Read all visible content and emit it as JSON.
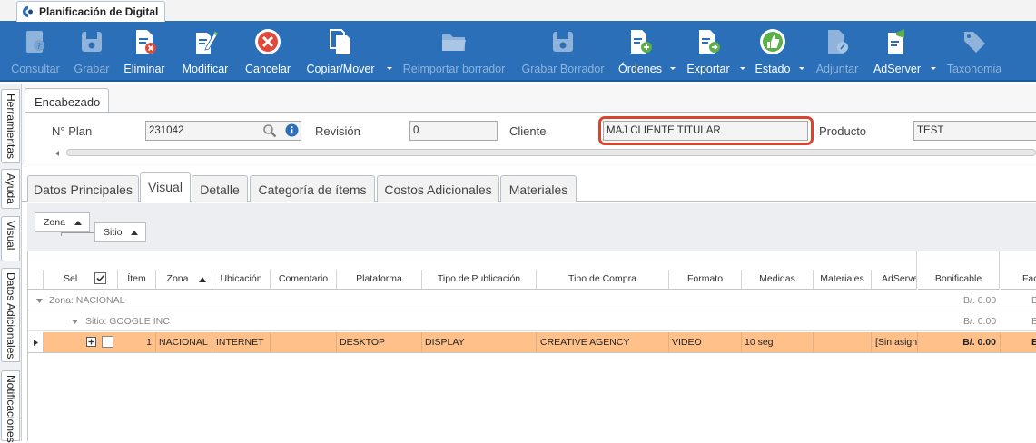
{
  "window": {
    "title": "Planificación de Digital"
  },
  "toolbar": {
    "buttons": [
      {
        "label": "Consultar",
        "icon": "consult-icon",
        "enabled": false
      },
      {
        "label": "Grabar",
        "icon": "save-icon",
        "enabled": false
      },
      {
        "label": "Eliminar",
        "icon": "delete-doc-icon",
        "enabled": true
      },
      {
        "label": "Modificar",
        "icon": "edit-doc-icon",
        "enabled": true
      },
      {
        "label": "Cancelar",
        "icon": "cancel-icon",
        "enabled": true
      },
      {
        "label": "Copiar/Mover",
        "icon": "copy-icon",
        "enabled": true
      },
      {
        "label": "Reimportar borrador",
        "icon": "folder-icon",
        "enabled": false
      },
      {
        "label": "Grabar Borrador",
        "icon": "save-draft-icon",
        "enabled": false
      },
      {
        "label": "Órdenes",
        "icon": "orders-icon",
        "enabled": true
      },
      {
        "label": "Exportar",
        "icon": "export-icon",
        "enabled": true
      },
      {
        "label": "Estado",
        "icon": "status-icon",
        "enabled": true
      },
      {
        "label": "Adjuntar",
        "icon": "attach-icon",
        "enabled": false
      },
      {
        "label": "AdServer",
        "icon": "adserver-icon",
        "enabled": true
      },
      {
        "label": "Taxonomia",
        "icon": "tag-icon",
        "enabled": false
      }
    ]
  },
  "sidebar": {
    "tabs": [
      "Herramientas",
      "Ayuda",
      "Visual",
      "Datos Adicionales",
      "Notificaciones"
    ]
  },
  "header": {
    "section_label": "Encabezado",
    "plan_label": "N° Plan",
    "plan_value": "231042",
    "revision_label": "Revisión",
    "revision_value": "0",
    "cliente_label": "Cliente",
    "cliente_value": "MAJ CLIENTE TITULAR",
    "producto_label": "Producto",
    "producto_value": "TEST"
  },
  "tabs": [
    "Datos Principales",
    "Visual",
    "Detalle",
    "Categoría de ítems",
    "Costos Adicionales",
    "Materiales"
  ],
  "active_tab": "Visual",
  "grouping": {
    "zona": "Zona",
    "sitio": "Sitio"
  },
  "grid": {
    "columns": [
      "Sel.",
      "Ítem",
      "Zona",
      "Ubicación",
      "Comentario",
      "Plataforma",
      "Tipo de Publicación",
      "Tipo de Compra",
      "Formato",
      "Medidas",
      "Materiales",
      "AdServer",
      "Bonificable",
      "Fac"
    ],
    "group_zona": "Zona: NACIONAL",
    "group_zona_amount": "B/. 0.00",
    "group_zona_trail": "B",
    "group_sitio": "Sitio: GOOGLE INC",
    "group_sitio_amount": "B/. 0.00",
    "group_sitio_trail": "B",
    "row": {
      "item": "1",
      "zona": "NACIONAL",
      "ubicacion": "INTERNET",
      "comentario": "",
      "plataforma": "DESKTOP",
      "tipo_publicacion": "DISPLAY",
      "tipo_compra": "CREATIVE AGENCY",
      "formato": "VIDEO",
      "medidas": "10 seg",
      "materiales": "",
      "adserver": "[Sin asigna",
      "bonificable": "B/. 0.00",
      "fac": "B"
    }
  },
  "colors": {
    "toolbar": "#2a6fb8",
    "row_highlight": "#ffc08a",
    "highlight_border": "#d9442f"
  }
}
